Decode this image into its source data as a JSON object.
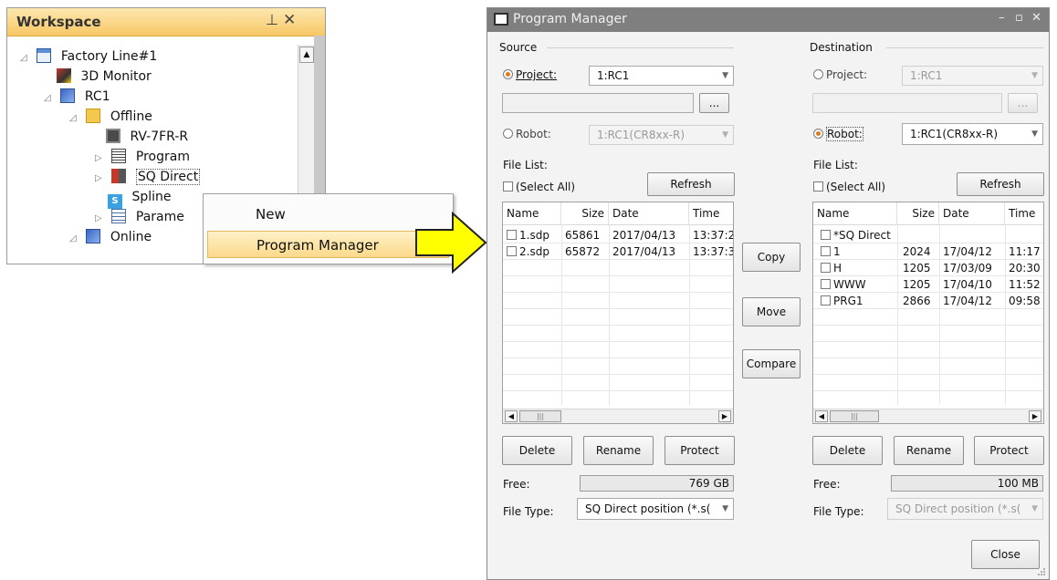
{
  "workspace": {
    "title": "Workspace",
    "pin_glyph": "⊥",
    "close_glyph": "✕",
    "tree": [
      {
        "label": "Factory Line#1",
        "icon": "workspace-icon"
      },
      {
        "label": "3D Monitor",
        "icon": "3d-monitor-icon"
      },
      {
        "label": "RC1",
        "icon": "robot-controller-icon"
      },
      {
        "label": "Offline",
        "icon": "offline-folder-icon"
      },
      {
        "label": "RV-7FR-R",
        "icon": "robot-model-icon"
      },
      {
        "label": "Program",
        "icon": "program-icon"
      },
      {
        "label": "SQ Direct",
        "icon": "sq-direct-icon"
      },
      {
        "label": "Spline",
        "icon": "spline-icon"
      },
      {
        "label": "Parame",
        "icon": "parameter-icon"
      },
      {
        "label": "Online",
        "icon": "online-icon"
      }
    ]
  },
  "context_menu": {
    "items": [
      "New",
      "Program Manager"
    ]
  },
  "colors": {
    "workspace_header": "#f7c765",
    "menu_highlight": "#fbd98a",
    "arrow_fill": "#ffff00",
    "titlebar": "#7f7f7f",
    "radio_selected": "#e07a1a"
  },
  "program_manager": {
    "title": "Program Manager",
    "title_buttons": [
      "–",
      "▫",
      "✕"
    ],
    "source": {
      "header": "Source",
      "project_label": "Project:",
      "project_value": "1:RC1",
      "browse": "...",
      "robot_label": "Robot:",
      "robot_value": "1:RC1(CR8xx-R)",
      "file_list_label": "File List:",
      "select_all": "(Select All)",
      "refresh": "Refresh",
      "columns": [
        "Name",
        "Size",
        "Date",
        "Time"
      ],
      "rows": [
        {
          "name": "1.sdp",
          "size": "65861",
          "date": "2017/04/13",
          "time": "13:37:2"
        },
        {
          "name": "2.sdp",
          "size": "65872",
          "date": "2017/04/13",
          "time": "13:37:3"
        }
      ],
      "delete": "Delete",
      "rename": "Rename",
      "protect": "Protect",
      "free_label": "Free:",
      "free_value": "769 GB",
      "file_type_label": "File Type:",
      "file_type_value": "SQ Direct position (*.s("
    },
    "middle": {
      "copy": "Copy",
      "move": "Move",
      "compare": "Compare"
    },
    "destination": {
      "header": "Destination",
      "project_label": "Project:",
      "project_value": "1:RC1",
      "browse": "...",
      "robot_label": "Robot:",
      "robot_value": "1:RC1(CR8xx-R)",
      "file_list_label": "File List:",
      "select_all": "(Select All)",
      "refresh": "Refresh",
      "columns": [
        "Name",
        "Size",
        "Date",
        "Time"
      ],
      "rows": [
        {
          "name": "*SQ Direct",
          "size": "",
          "date": "",
          "time": ""
        },
        {
          "name": "1",
          "size": "2024",
          "date": "17/04/12",
          "time": "11:17"
        },
        {
          "name": "H",
          "size": "1205",
          "date": "17/03/09",
          "time": "20:30"
        },
        {
          "name": "WWW",
          "size": "1205",
          "date": "17/04/10",
          "time": "11:52"
        },
        {
          "name": "PRG1",
          "size": "2866",
          "date": "17/04/12",
          "time": "09:58"
        }
      ],
      "delete": "Delete",
      "rename": "Rename",
      "protect": "Protect",
      "free_label": "Free:",
      "free_value": "100 MB",
      "file_type_label": "File Type:",
      "file_type_value": "SQ Direct position (*.s("
    },
    "close": "Close"
  }
}
